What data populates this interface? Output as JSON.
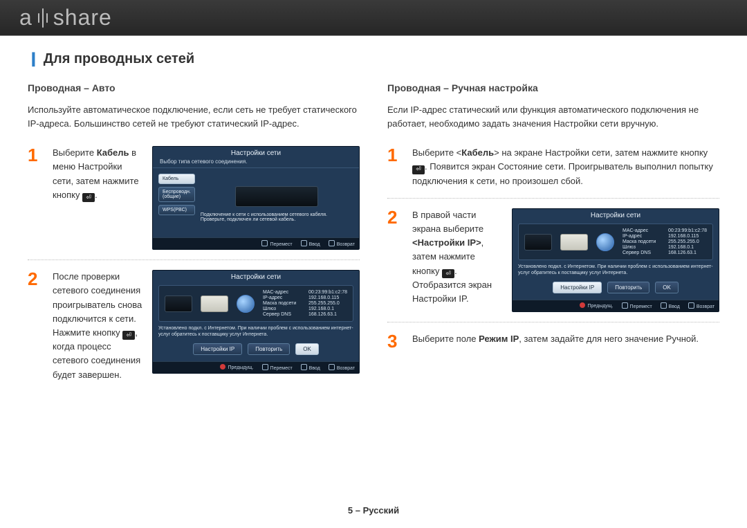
{
  "header": {
    "logo_a": "a",
    "logo_b": "share"
  },
  "section": {
    "accent": "❙",
    "title": "Для проводных сетей"
  },
  "left": {
    "subhead": "Проводная – Авто",
    "intro": "Используйте автоматическое подключение, если сеть не требует статического IP-адреса. Большинство сетей не требуют статический IP-адрес.",
    "step1": {
      "pre": "Выберите ",
      "bold": "Кабель",
      "mid": " в меню Настройки сети, затем нажмите кнопку ",
      "post": "."
    },
    "step2": {
      "pre": "После проверки сетевого соединения проигрыватель снова подключится к сети. Нажмите кнопку ",
      "post": ", когда процесс сетевого соединения будет завершен."
    }
  },
  "right": {
    "subhead": "Проводная – Ручная настройка",
    "intro": "Если IP-адрес статический или функция автоматического подключения не работает, необходимо задать значения Настройки сети вручную.",
    "step1": {
      "pre": "Выберите <",
      "bold": "Кабель",
      "mid": "> на экране Настройки сети, затем нажмите кнопку ",
      "post": ". Появится экран Состояние сети. Проигрыватель выполнил попытку подключения к сети, но произошел сбой."
    },
    "step2": {
      "pre": "В правой части экрана выберите ",
      "bold": "<Настройки IP>",
      "mid": ", затем нажмите кнопку ",
      "post": ". Отобразится экран Настройки IP."
    },
    "step3": {
      "pre": "Выберите поле ",
      "bold": "Режим IP",
      "post": ", затем задайте для него значение Ручной."
    }
  },
  "tv": {
    "title": "Настройки сети",
    "select_sub": "Выбор типа сетевого соединения.",
    "tabs": {
      "cable": "Кабель",
      "wireless": "Беспроводн. (общие)",
      "wps": "WPS(PBC)"
    },
    "cable_note": "Подключение к сети с использованием сетевого кабеля. Проверьте, подключен ли сетевой кабель.",
    "bottom": {
      "prev": "Предыдущ.",
      "move": "Перемест",
      "enter": "Ввод",
      "return": "Возврат"
    },
    "msg": "Установлено подкл. с Интернетом. При наличии проблем с использованием интернет-услуг обратитесь к поставщику услуг Интернета.",
    "actions": {
      "ip": "Настройки IP",
      "retry": "Повторить",
      "ok": "OK"
    },
    "info": {
      "mac_k": "MAC-адрес",
      "mac_v": "00:23:99:b1:c2:78",
      "ip_k": "IP-адрес",
      "ip_v": "192.168.0.115",
      "mask_k": "Маска подсети",
      "mask_v": "255.255.255.0",
      "gw_k": "Шлюз",
      "gw_v": "192.168.0.1",
      "dns_k": "Сервер DNS",
      "dns_v": "168.126.63.1"
    }
  },
  "footer": "5 – Русский",
  "enter_glyph": "⏎"
}
